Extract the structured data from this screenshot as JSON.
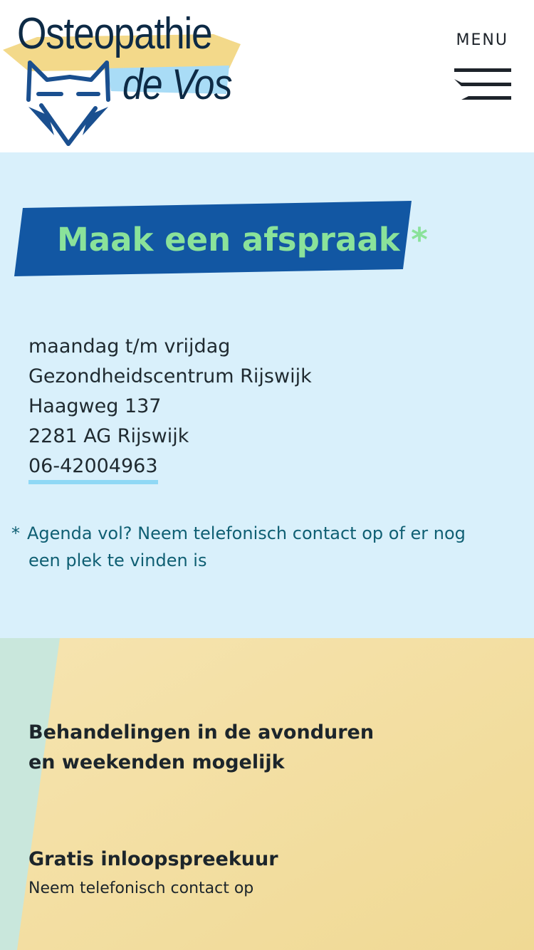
{
  "header": {
    "logo_line1": "Osteopathie",
    "logo_line2": "de Vos",
    "menu_label": "MENU"
  },
  "appointment": {
    "title": "Maak een afspraak *",
    "address": {
      "days": "maandag t/m vrijdag",
      "location": "Gezondheidscentrum Rijswijk",
      "street": "Haagweg 137",
      "postal_city": "2281 AG Rijswijk",
      "phone": "06-42004963"
    },
    "note_star": "*",
    "note_line1": "Agenda vol? Neem telefonisch contact op of er nog",
    "note_line2": "een plek te vinden is"
  },
  "info": {
    "evening_title": "Behandelingen in de avonduren en weekenden mogelijk",
    "walkin_title": "Gratis inloopspreekuur",
    "walkin_sub": "Neem telefonisch contact op"
  },
  "colors": {
    "navy": "#0d2a45",
    "banner_blue": "#1257a3",
    "banner_text": "#8ae29a",
    "light_blue_bg": "#d9f0fb",
    "yellow_bg": "#f3dfa0",
    "mint_stripe": "#c9e7dc",
    "phone_underline": "#8fd8f5",
    "note_text": "#0f5f73"
  },
  "icons": [
    "fox-logo-icon",
    "hamburger-menu-icon"
  ]
}
